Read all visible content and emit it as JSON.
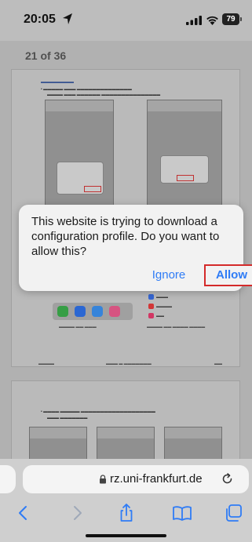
{
  "status_bar": {
    "time": "20:05",
    "battery": "79",
    "icons": [
      "location-arrow-icon",
      "signal-icon",
      "wifi-icon",
      "battery-icon"
    ]
  },
  "page_counter": "21 of 36",
  "alert": {
    "message": "This website is trying to download a configuration profile. Do you want to allow this?",
    "ignore_label": "Ignore",
    "allow_label": "Allow"
  },
  "url_bar": {
    "url": "rz.uni-frankfurt.de",
    "icons": [
      "lock-icon",
      "reload-icon"
    ]
  },
  "toolbar": {
    "icons": [
      "back-icon",
      "forward-icon",
      "share-icon",
      "bookmarks-icon",
      "tabs-icon"
    ]
  },
  "colors": {
    "accent": "#2f7cf6",
    "highlight": "#d42a2a",
    "backdrop": "#bdbdbd"
  }
}
